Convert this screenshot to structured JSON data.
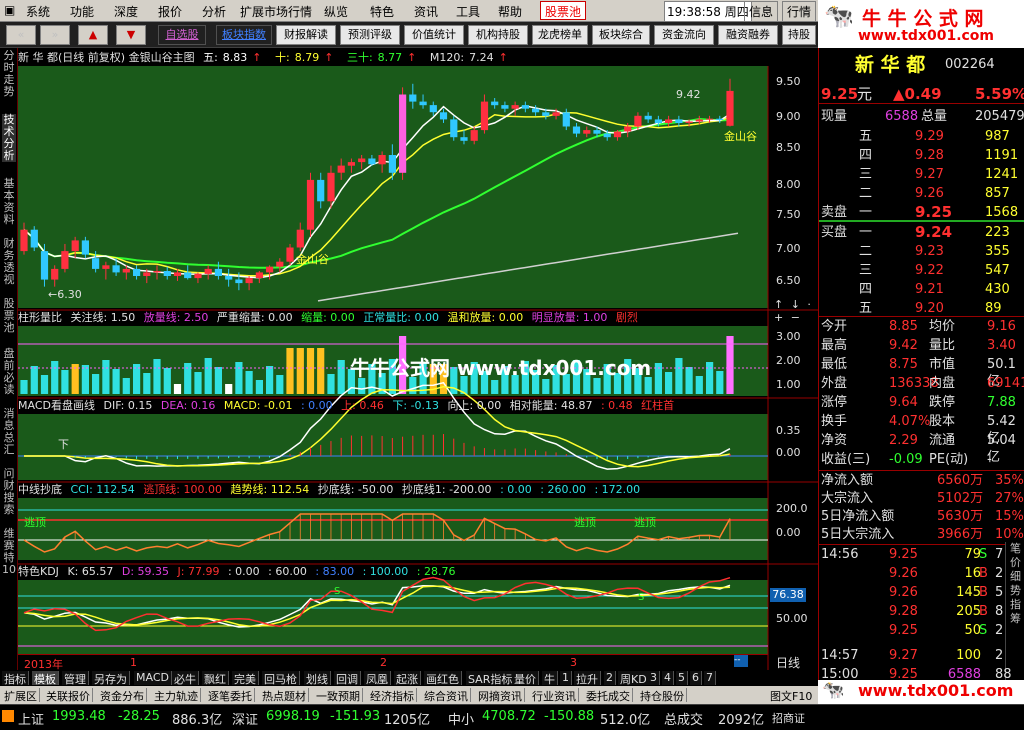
{
  "menu": [
    "系统",
    "功能",
    "深度",
    "报价",
    "分析",
    "扩展市场行情",
    "纵览",
    "特色",
    "资讯",
    "工具",
    "帮助"
  ],
  "menu_extra": {
    "stockpool": "股票池",
    "time": "19:38:58",
    "weekday": "周四",
    "info": "信息",
    "quote": "行情"
  },
  "toolbar": {
    "buttons": [
      "自选股",
      "板块指数",
      "财报解读",
      "预测评级",
      "价值统计",
      "机构持股",
      "龙虎榜单",
      "板块综合",
      "资金流向",
      "融资融券",
      "持股"
    ]
  },
  "watermark": {
    "top": "牛 牛 公 式 网",
    "url": "www.tdx001.com",
    "center": "牛牛公式网 www.tdx001.com"
  },
  "lefttabs": [
    "分时走势",
    "技术分析",
    "基本资料",
    "财务透视",
    "股票池",
    "盘前必读",
    "消息总汇",
    "问财搜索",
    "维赛特10"
  ],
  "main": {
    "title": "新 华 都(日线 前复权) 金银山谷主图",
    "ma": [
      {
        "label": "五:",
        "value": "8.83",
        "color": "#ffffff"
      },
      {
        "label": "十:",
        "value": "8.79",
        "color": "#ffff30"
      },
      {
        "label": "三十:",
        "value": "8.77",
        "color": "#30ff30"
      },
      {
        "label": "M120:",
        "value": "7.24",
        "color": "#e0e0e0"
      }
    ],
    "axis": [
      "9.50",
      "9.00",
      "8.50",
      "8.00",
      "7.50",
      "7.00",
      "6.50"
    ],
    "ann_high": "9.42",
    "ann_low": "6.30",
    "ann_jys1": "金山谷",
    "ann_jys2": "金山谷"
  },
  "vol": {
    "items": [
      "柱形量比",
      "关注线: 1.50",
      "放量线: 2.50",
      "严重缩量: 0.00",
      "缩量: 0.00",
      "正常量比: 0.00",
      "温和放量: 0.00",
      "明显放量: 1.00",
      "剧烈"
    ],
    "axis": [
      "3.00",
      "2.00",
      "1.00"
    ]
  },
  "macd": {
    "items": [
      "MACD看盘画线",
      "DIF: 0.15",
      "DEA: 0.16",
      "MACD: -0.01",
      ": 0.00",
      "上: 0.46",
      "下: -0.13",
      "向上: 0.00",
      "相对能量: 48.87",
      ": 0.48",
      "红柱首"
    ],
    "axis": [
      "0.35",
      "0.00"
    ],
    "label_top": "下"
  },
  "cci": {
    "items": [
      "中线抄底",
      "CCI: 112.54",
      "逃顶线: 100.00",
      "趋势线: 112.54",
      "抄底线: -50.00",
      "抄底线1: -200.00",
      ": 0.00",
      ": 260.00",
      ": 172.00"
    ],
    "axis": [
      "200.0",
      "0.00"
    ],
    "tag": "逃顶"
  },
  "kdj": {
    "items": [
      "特色KDJ",
      "K: 65.57",
      "D: 59.35",
      "J: 77.99",
      ": 0.00",
      ": 60.00",
      ": 83.00",
      ": 100.00",
      ": 28.76"
    ],
    "axis": [
      "76.38",
      "50.00"
    ],
    "tag": "S"
  },
  "timeaxis": {
    "year": "2013年",
    "m1": "1",
    "m2": "2",
    "m3": "3",
    "period": "日线"
  },
  "bottom_tabs": [
    "指标",
    "模板",
    "管理",
    "另存为",
    "MACD",
    "必牛",
    "飘红",
    "完美",
    "回马枪",
    "划线",
    "回调",
    "凤凰",
    "起涨",
    "画红色",
    "SAR指标",
    "量价",
    "牛",
    "1",
    "拉升",
    "2",
    "周KD",
    "3",
    "4",
    "5",
    "6",
    "7"
  ],
  "bottom_tabs2": [
    "扩展区",
    "关联报价",
    "资金分布",
    "主力轨迹",
    "逐笔委托",
    "热点题材",
    "一致预期",
    "经济指标",
    "综合资讯",
    "网摘资讯",
    "行业资讯",
    "委托成交",
    "持仓股份"
  ],
  "bottom_right": {
    "f10": "图文F10",
    "zs": "招商证"
  },
  "stock": {
    "name": "新 华 都",
    "code": "002264",
    "price": "9.25",
    "price_unit": "元",
    "change": "▲0.49",
    "pct": "5.59%"
  },
  "quote": {
    "now_label": "现量",
    "now": "6588",
    "total_label": "总量",
    "total": "205479",
    "sell_label": "卖盘",
    "buy_label": "买盘",
    "asks": [
      {
        "l": "五",
        "p": "9.29",
        "v": "987"
      },
      {
        "l": "四",
        "p": "9.28",
        "v": "1191"
      },
      {
        "l": "三",
        "p": "9.27",
        "v": "1241"
      },
      {
        "l": "二",
        "p": "9.26",
        "v": "857"
      },
      {
        "l": "一",
        "p": "9.25",
        "v": "1568"
      }
    ],
    "bids": [
      {
        "l": "一",
        "p": "9.24",
        "v": "223"
      },
      {
        "l": "二",
        "p": "9.23",
        "v": "355"
      },
      {
        "l": "三",
        "p": "9.22",
        "v": "547"
      },
      {
        "l": "四",
        "p": "9.21",
        "v": "430"
      },
      {
        "l": "五",
        "p": "9.20",
        "v": "89"
      }
    ]
  },
  "stats": [
    {
      "l": "今开",
      "v": "8.85",
      "l2": "均价",
      "v2": "9.16"
    },
    {
      "l": "最高",
      "v": "9.42",
      "l2": "量比",
      "v2": "3.40"
    },
    {
      "l": "最低",
      "v": "8.75",
      "l2": "市值",
      "v2": "50.1亿"
    },
    {
      "l": "外盘",
      "v": "136338",
      "l2": "内盘",
      "v2": "69141"
    },
    {
      "l": "涨停",
      "v": "9.64",
      "l2": "跌停",
      "v2": "7.88"
    },
    {
      "l": "换手",
      "v": "4.07%",
      "l2": "股本",
      "v2": "5.42亿"
    },
    {
      "l": "净资",
      "v": "2.29",
      "l2": "流通",
      "v2": "5.04亿"
    },
    {
      "l": "收益(三)",
      "v": "-0.09",
      "l2": "PE(动)",
      "v2": "-"
    }
  ],
  "flows": [
    {
      "l": "净流入额",
      "v": "6560万",
      "p": "35%"
    },
    {
      "l": "大宗流入",
      "v": "5102万",
      "p": "27%"
    },
    {
      "l": "5日净流入额",
      "v": "5630万",
      "p": "15%"
    },
    {
      "l": "5日大宗流入",
      "v": "3966万",
      "p": "10%"
    }
  ],
  "ticks": [
    {
      "t": "14:56",
      "p": "9.25",
      "v": "79",
      "s": "S",
      "n": "7"
    },
    {
      "t": "",
      "p": "9.26",
      "v": "16",
      "s": "B",
      "n": "2"
    },
    {
      "t": "",
      "p": "9.26",
      "v": "145",
      "s": "B",
      "n": "5"
    },
    {
      "t": "",
      "p": "9.28",
      "v": "205",
      "s": "B",
      "n": "8"
    },
    {
      "t": "",
      "p": "9.25",
      "v": "50",
      "s": "S",
      "n": "2"
    },
    {
      "t": "14:57",
      "p": "9.27",
      "v": "100",
      "s": "",
      "n": "2"
    },
    {
      "t": "15:00",
      "p": "9.25",
      "v": "6588",
      "s": "",
      "n": "88"
    }
  ],
  "rp_tabs": {
    "a": "笔",
    "b": "价",
    "c": "细",
    "d": "势",
    "e": "指",
    "f": "筹"
  },
  "status": {
    "sh_label": "上证",
    "sh": "1993.48",
    "sh_chg": "-28.25",
    "sh_amt": "886.3亿",
    "sz_label": "深证",
    "sz": "6998.19",
    "sz_chg": "-151.93",
    "sz_amt": "1205亿",
    "zx_label": "中小",
    "zx": "4708.72",
    "zx_chg": "-150.88",
    "zx_amt": "512.0亿",
    "tot_label": "总成交",
    "tot": "2092亿"
  },
  "chart_data": {
    "type": "candlestick",
    "title": "新 华 都(日线 前复权) 金银山谷主图",
    "ylim": [
      6.2,
      9.6
    ],
    "candles": [
      [
        7.0,
        7.4,
        6.95,
        7.3
      ],
      [
        7.3,
        7.35,
        7.0,
        7.05
      ],
      [
        7.0,
        7.1,
        6.5,
        6.6
      ],
      [
        6.6,
        6.8,
        6.5,
        6.75
      ],
      [
        6.75,
        7.1,
        6.7,
        7.0
      ],
      [
        7.0,
        7.2,
        6.9,
        7.15
      ],
      [
        7.15,
        7.2,
        6.9,
        6.95
      ],
      [
        6.9,
        7.0,
        6.7,
        6.75
      ],
      [
        6.75,
        6.85,
        6.6,
        6.8
      ],
      [
        6.8,
        6.9,
        6.65,
        6.7
      ],
      [
        6.7,
        6.8,
        6.6,
        6.75
      ],
      [
        6.75,
        6.8,
        6.6,
        6.65
      ],
      [
        6.65,
        6.75,
        6.55,
        6.7
      ],
      [
        6.7,
        6.8,
        6.6,
        6.72
      ],
      [
        6.72,
        6.78,
        6.6,
        6.65
      ],
      [
        6.65,
        6.75,
        6.58,
        6.7
      ],
      [
        6.7,
        6.8,
        6.6,
        6.62
      ],
      [
        6.62,
        6.7,
        6.55,
        6.68
      ],
      [
        6.68,
        6.8,
        6.6,
        6.75
      ],
      [
        6.75,
        6.85,
        6.6,
        6.65
      ],
      [
        6.65,
        6.75,
        6.5,
        6.6
      ],
      [
        6.6,
        6.7,
        6.45,
        6.55
      ],
      [
        6.55,
        6.65,
        6.45,
        6.62
      ],
      [
        6.62,
        6.72,
        6.55,
        6.7
      ],
      [
        6.7,
        6.8,
        6.6,
        6.78
      ],
      [
        6.78,
        6.9,
        6.7,
        6.85
      ],
      [
        6.85,
        7.1,
        6.8,
        7.05
      ],
      [
        7.05,
        7.4,
        7.0,
        7.3
      ],
      [
        7.3,
        8.1,
        7.2,
        8.0
      ],
      [
        8.0,
        8.1,
        7.6,
        7.7
      ],
      [
        7.7,
        8.2,
        7.6,
        8.1
      ],
      [
        8.1,
        8.3,
        8.0,
        8.2
      ],
      [
        8.2,
        8.3,
        8.1,
        8.25
      ],
      [
        8.25,
        8.35,
        8.15,
        8.3
      ],
      [
        8.3,
        8.35,
        8.2,
        8.22
      ],
      [
        8.22,
        8.4,
        8.1,
        8.35
      ],
      [
        8.35,
        8.5,
        8.0,
        8.1
      ],
      [
        8.1,
        9.3,
        8.0,
        9.2
      ],
      [
        9.2,
        9.35,
        9.0,
        9.1
      ],
      [
        9.1,
        9.2,
        9.0,
        9.05
      ],
      [
        9.05,
        9.1,
        8.9,
        8.95
      ],
      [
        8.95,
        9.0,
        8.8,
        8.85
      ],
      [
        8.85,
        8.9,
        8.55,
        8.6
      ],
      [
        8.6,
        8.7,
        8.5,
        8.55
      ],
      [
        8.55,
        8.75,
        8.5,
        8.7
      ],
      [
        8.7,
        9.2,
        8.65,
        9.1
      ],
      [
        9.1,
        9.15,
        9.0,
        9.05
      ],
      [
        9.05,
        9.1,
        8.95,
        9.0
      ],
      [
        9.0,
        9.1,
        8.9,
        9.05
      ],
      [
        9.05,
        9.1,
        8.95,
        9.0
      ],
      [
        9.0,
        9.05,
        8.9,
        8.95
      ],
      [
        8.95,
        9.0,
        8.85,
        8.9
      ],
      [
        8.9,
        9.0,
        8.85,
        8.95
      ],
      [
        8.95,
        9.0,
        8.7,
        8.75
      ],
      [
        8.75,
        8.8,
        8.6,
        8.65
      ],
      [
        8.65,
        8.75,
        8.6,
        8.7
      ],
      [
        8.7,
        8.75,
        8.6,
        8.65
      ],
      [
        8.65,
        8.7,
        8.55,
        8.6
      ],
      [
        8.6,
        8.7,
        8.55,
        8.68
      ],
      [
        8.68,
        8.8,
        8.6,
        8.75
      ],
      [
        8.75,
        8.95,
        8.7,
        8.9
      ],
      [
        8.9,
        8.95,
        8.8,
        8.85
      ],
      [
        8.85,
        8.9,
        8.75,
        8.8
      ],
      [
        8.8,
        8.9,
        8.75,
        8.85
      ],
      [
        8.85,
        8.9,
        8.75,
        8.8
      ],
      [
        8.8,
        8.85,
        8.75,
        8.82
      ],
      [
        8.82,
        8.9,
        8.78,
        8.85
      ],
      [
        8.85,
        8.9,
        8.8,
        8.86
      ],
      [
        8.86,
        8.9,
        8.8,
        8.84
      ],
      [
        8.76,
        9.42,
        8.75,
        9.25
      ]
    ]
  }
}
